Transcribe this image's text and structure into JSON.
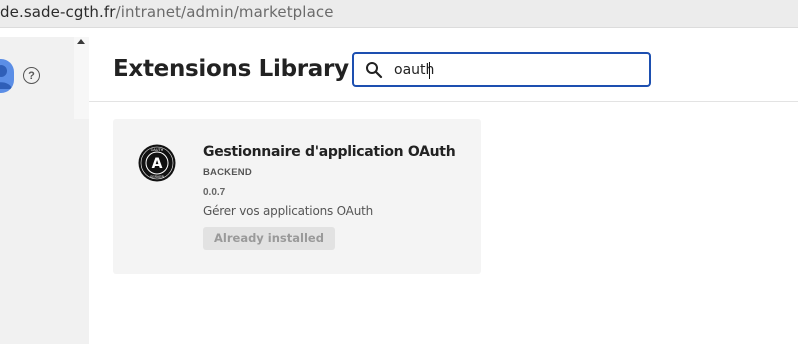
{
  "browser": {
    "url_host": "de.sade-cgth.fr",
    "url_path": "/intranet/admin/marketplace"
  },
  "sidebar": {
    "avatar_icon": "user-avatar-icon",
    "help_icon": "help-circle-icon",
    "help_glyph": "?"
  },
  "header": {
    "title": "Extensions Library",
    "search": {
      "value": "oauth",
      "icon": "search-icon"
    }
  },
  "results": [
    {
      "name": "Gestionnaire d'application OAuth",
      "type": "BACKEND",
      "version": "0.0.7",
      "description": "Gérer vos applications OAuth",
      "action_label": "Already installed",
      "logo_icon": "oauth-logo-icon",
      "logo_letter": "A",
      "logo_top_text": "OAUTH",
      "logo_bottom_text": "SERVER"
    }
  ],
  "colors": {
    "accent": "#1d4fb0",
    "card_bg": "#f4f4f4",
    "sidebar_bg": "#f1f1f1",
    "avatar": "#5b8ee6"
  }
}
